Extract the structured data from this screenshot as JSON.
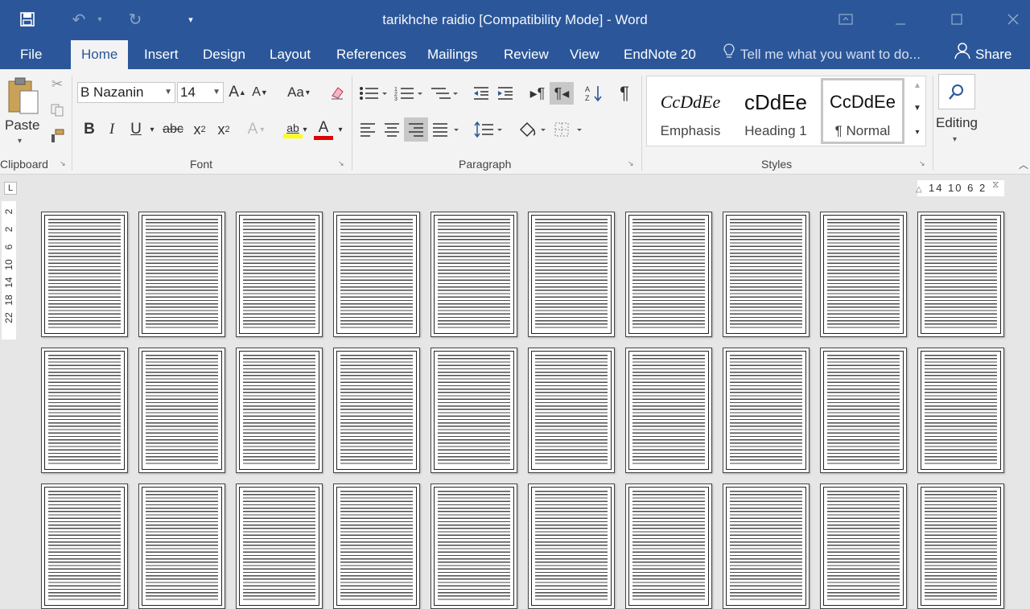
{
  "window": {
    "title": "tarikhche raidio [Compatibility Mode] - Word",
    "qat": {
      "save_icon": "save-icon",
      "undo_icon": "undo-icon",
      "redo_icon": "redo-icon",
      "customize_icon": "customize-qat-icon"
    },
    "controls": [
      "ribbon-display-icon",
      "minimize-icon",
      "maximize-icon",
      "close-icon"
    ]
  },
  "tabs": [
    {
      "label": "File"
    },
    {
      "label": "Home",
      "active": true
    },
    {
      "label": "Insert"
    },
    {
      "label": "Design"
    },
    {
      "label": "Layout"
    },
    {
      "label": "References"
    },
    {
      "label": "Mailings"
    },
    {
      "label": "Review"
    },
    {
      "label": "View"
    },
    {
      "label": "EndNote 20"
    }
  ],
  "tell_me": {
    "placeholder": "Tell me what you want to do...",
    "icon": "lightbulb-icon"
  },
  "share": {
    "label": "Share",
    "icon": "person-icon"
  },
  "clipboard": {
    "group_label": "Clipboard",
    "paste_label": "Paste"
  },
  "font": {
    "group_label": "Font",
    "name": "B Nazanin",
    "size": "14",
    "grow_label": "A",
    "shrink_label": "A",
    "case_label": "Aa",
    "bold": "B",
    "italic": "I",
    "underline": "U",
    "strike": "abc",
    "subscript": "x",
    "sub_index": "2",
    "superscript": "x",
    "sup_index": "2",
    "effects": "A",
    "highlight": "ab",
    "font_color": "A",
    "highlight_color": "#ffff00",
    "font_color_bar": "#e00000"
  },
  "paragraph": {
    "group_label": "Paragraph",
    "pilcrow": "¶"
  },
  "styles": {
    "group_label": "Styles",
    "items": [
      {
        "preview": "CcDdEe",
        "name": "Emphasis"
      },
      {
        "preview": "cDdEe",
        "name": "Heading 1"
      },
      {
        "preview": "CcDdEe",
        "name": "¶ Normal",
        "selected": true
      }
    ]
  },
  "editing": {
    "label": "Editing",
    "icon": "search-icon"
  },
  "ruler": {
    "horizontal": "14 10 6 2",
    "vertical": [
      "2",
      "2",
      "6",
      "10",
      "14",
      "18",
      "22"
    ],
    "tab_selector": "L"
  },
  "pages": {
    "rows": 3,
    "columns": 10,
    "count": 30
  },
  "colors": {
    "accent": "#2b579a",
    "ribbon": "#f3f3f3",
    "workspace": "#e6e6e6"
  }
}
